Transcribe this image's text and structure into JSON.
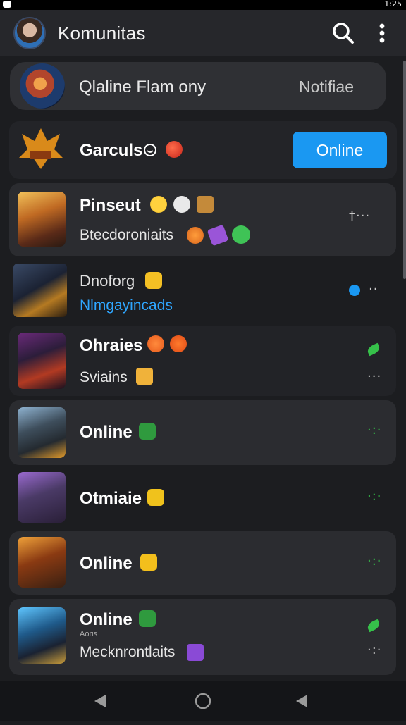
{
  "status": {
    "time": "1:25"
  },
  "header": {
    "title": "Komunitas"
  },
  "featured": {
    "title": "Qlaline Flam ony",
    "action": "Notifiae"
  },
  "group": {
    "name": "Garculs",
    "action": "Online"
  },
  "rows": [
    {
      "name": "Pinseut",
      "sub": "Btecdoroniaits",
      "trail": "†···"
    },
    {
      "name": "Dnoforg",
      "sub": "Nlmgayincads",
      "trail": "··"
    },
    {
      "name": "Ohraies",
      "sub": "Sviains",
      "trail": "···"
    },
    {
      "name": "Online",
      "trail": "·:·"
    },
    {
      "name": "Otmiaie",
      "trail": "·:·"
    },
    {
      "name": "Online",
      "trail": "·:·"
    },
    {
      "name": "Online",
      "small": "Aoris",
      "sub": "Mecknrontlaits",
      "trail": "·:·"
    }
  ],
  "colors": {
    "accent": "#1a98f2",
    "online_green": "#36c14a",
    "card": "#2b2c30",
    "bg": "#1c1d20"
  }
}
